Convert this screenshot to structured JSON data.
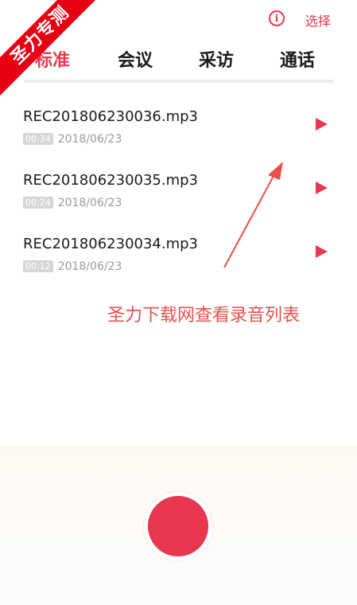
{
  "ribbon": {
    "text": "圣力专测"
  },
  "header": {
    "info_icon_glyph": "i",
    "select_label": "选择"
  },
  "tabs": [
    {
      "label": "标准",
      "active": true
    },
    {
      "label": "会议",
      "active": false
    },
    {
      "label": "采访",
      "active": false
    },
    {
      "label": "通话",
      "active": false
    }
  ],
  "recordings": [
    {
      "name": "REC201806230036.mp3",
      "duration": "00:34",
      "date": "2018/06/23"
    },
    {
      "name": "REC201806230035.mp3",
      "duration": "00:24",
      "date": "2018/06/23"
    },
    {
      "name": "REC201806230034.mp3",
      "duration": "00:12",
      "date": "2018/06/23"
    }
  ],
  "annotation": {
    "text": "圣力下载网查看录音列表"
  },
  "colors": {
    "accent": "#e63950",
    "ribbon": "#e60012",
    "annotation": "#e8504a"
  }
}
